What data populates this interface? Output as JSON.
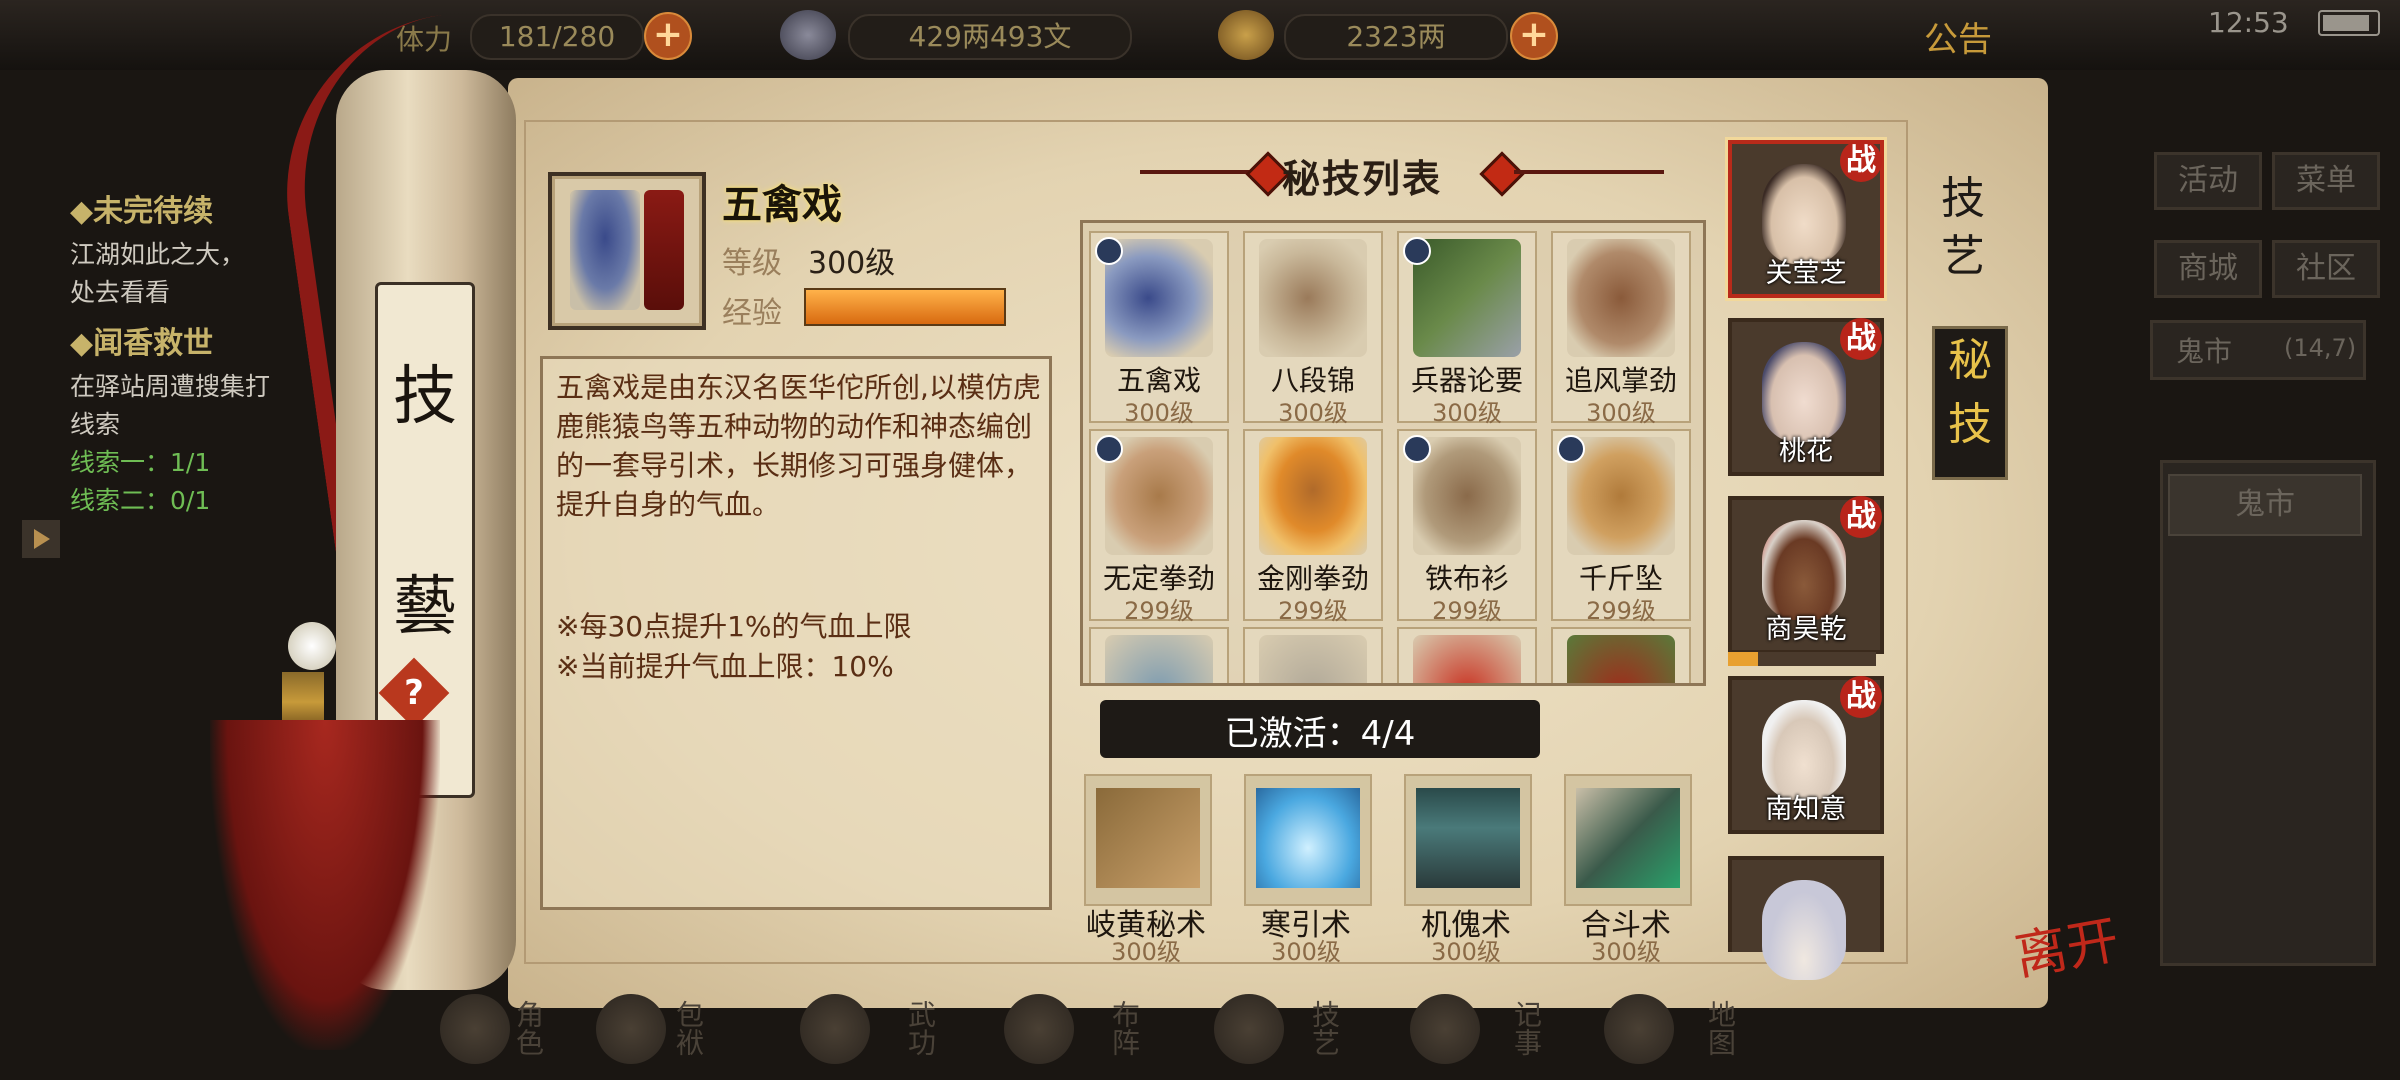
{
  "topbar": {
    "stamina_label": "体力",
    "stamina": "181/280",
    "silver": "429两493文",
    "gold": "2323两",
    "notice": "公告",
    "clock": "12:53"
  },
  "quests": {
    "q1_title": "◆未完待续",
    "q1_text": "江湖如此之大，",
    "q1_text2": "处去看看",
    "q2_title": "◆闻香救世",
    "q2_text": "在驿站周遭搜集打",
    "q2_text2": "线索",
    "clue1": "线索一：1/1",
    "clue2": "线索二：0/1"
  },
  "scroll": {
    "char1": "技",
    "char2": "藝",
    "help": "?"
  },
  "skill": {
    "name": "五禽戏",
    "level_label": "等级",
    "level": "300级",
    "exp_label": "经验",
    "exp_fraction": 1.0,
    "desc": "五禽戏是由东汉名医华佗所创,以模仿虎鹿熊猿鸟等五种动物的动作和神态编创的一套导引术，长期修习可强身健体，提升自身的气血。",
    "note1": "※每30点提升1%的气血上限",
    "note2": "※当前提升气血上限：10%"
  },
  "list": {
    "title": "秘技列表",
    "items": [
      {
        "name": "五禽戏",
        "level": "300级"
      },
      {
        "name": "八段锦",
        "level": "300级"
      },
      {
        "name": "兵器论要",
        "level": "300级"
      },
      {
        "name": "追风掌劲",
        "level": "300级"
      },
      {
        "name": "无定拳劲",
        "level": "299级"
      },
      {
        "name": "金刚拳劲",
        "level": "299级"
      },
      {
        "name": "铁布衫",
        "level": "299级"
      },
      {
        "name": "千斤坠",
        "level": "299级"
      }
    ],
    "activated": "已激活：4/4"
  },
  "tools": [
    {
      "name": "岐黄秘术",
      "level": "300级"
    },
    {
      "name": "寒引术",
      "level": "300级"
    },
    {
      "name": "机傀术",
      "level": "300级"
    },
    {
      "name": "合斗术",
      "level": "300级"
    }
  ],
  "characters": [
    {
      "name": "关莹芝",
      "tag": "战"
    },
    {
      "name": "桃花",
      "tag": "战"
    },
    {
      "name": "商昊乾",
      "tag": "战"
    },
    {
      "name": "南知意",
      "tag": "战"
    }
  ],
  "tabs": {
    "t1a": "技",
    "t1b": "艺",
    "t2a": "秘",
    "t2b": "技"
  },
  "side": {
    "activity": "活动",
    "menu": "菜单",
    "shop": "商城",
    "community": "社区",
    "location": "鬼市",
    "coords": "(14,7)",
    "location_btn": "鬼市",
    "leave": "离开"
  },
  "nav": [
    "角色",
    "包袱",
    "武功",
    "布阵",
    "技艺",
    "记事",
    "地图"
  ]
}
